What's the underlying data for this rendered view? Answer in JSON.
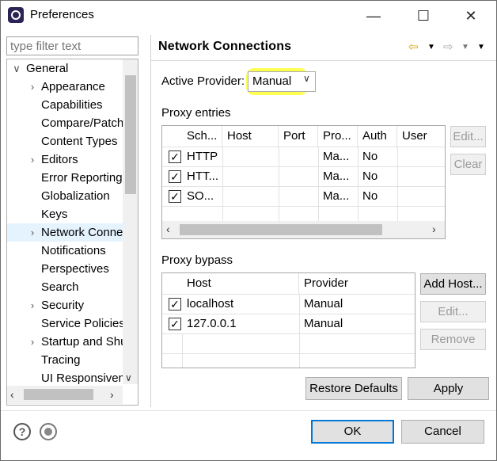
{
  "window": {
    "title": "Preferences",
    "minimize_glyph": "—",
    "maximize_glyph": "☐",
    "close_glyph": "✕"
  },
  "left": {
    "filter_placeholder": "type filter text",
    "tree": [
      {
        "label": "General",
        "arrow": "∨"
      },
      {
        "label": "Appearance",
        "arrow": "›"
      },
      {
        "label": "Capabilities",
        "arrow": ""
      },
      {
        "label": "Compare/Patch",
        "arrow": ""
      },
      {
        "label": "Content Types",
        "arrow": ""
      },
      {
        "label": "Editors",
        "arrow": "›"
      },
      {
        "label": "Error Reporting",
        "arrow": ""
      },
      {
        "label": "Globalization",
        "arrow": ""
      },
      {
        "label": "Keys",
        "arrow": ""
      },
      {
        "label": "Network Connections",
        "arrow": "›"
      },
      {
        "label": "Notifications",
        "arrow": ""
      },
      {
        "label": "Perspectives",
        "arrow": ""
      },
      {
        "label": "Search",
        "arrow": ""
      },
      {
        "label": "Security",
        "arrow": "›"
      },
      {
        "label": "Service Policies",
        "arrow": ""
      },
      {
        "label": "Startup and Shutdown",
        "arrow": "›"
      },
      {
        "label": "Tracing",
        "arrow": ""
      },
      {
        "label": "UI Responsiveness",
        "arrow": ""
      }
    ]
  },
  "main": {
    "heading": "Network Connections",
    "active_provider_label": "Active Provider:",
    "active_provider_value": "Manual",
    "proxy_entries": {
      "title": "Proxy entries",
      "columns": [
        "Sch...",
        "Host",
        "Port",
        "Pro...",
        "Auth",
        "User"
      ],
      "rows": [
        {
          "checked": true,
          "scheme": "HTTP",
          "host": "",
          "port": "",
          "provider": "Ma...",
          "auth": "No",
          "user": ""
        },
        {
          "checked": true,
          "scheme": "HTT...",
          "host": "",
          "port": "",
          "provider": "Ma...",
          "auth": "No",
          "user": ""
        },
        {
          "checked": true,
          "scheme": "SO...",
          "host": "",
          "port": "",
          "provider": "Ma...",
          "auth": "No",
          "user": ""
        }
      ],
      "edit_label": "Edit...",
      "clear_label": "Clear"
    },
    "proxy_bypass": {
      "title": "Proxy bypass",
      "columns": [
        "Host",
        "Provider"
      ],
      "rows": [
        {
          "checked": true,
          "host": "localhost",
          "provider": "Manual"
        },
        {
          "checked": true,
          "host": "127.0.0.1",
          "provider": "Manual"
        }
      ],
      "add_host_label": "Add Host...",
      "edit_label": "Edit...",
      "remove_label": "Remove"
    },
    "restore_defaults_label": "Restore Defaults",
    "apply_label": "Apply"
  },
  "footer": {
    "help_glyph": "?",
    "ok_label": "OK",
    "cancel_label": "Cancel"
  },
  "colors": {
    "highlight": "#ffff33",
    "selection": "#e5f3ff",
    "ok_border": "#0078d7"
  }
}
